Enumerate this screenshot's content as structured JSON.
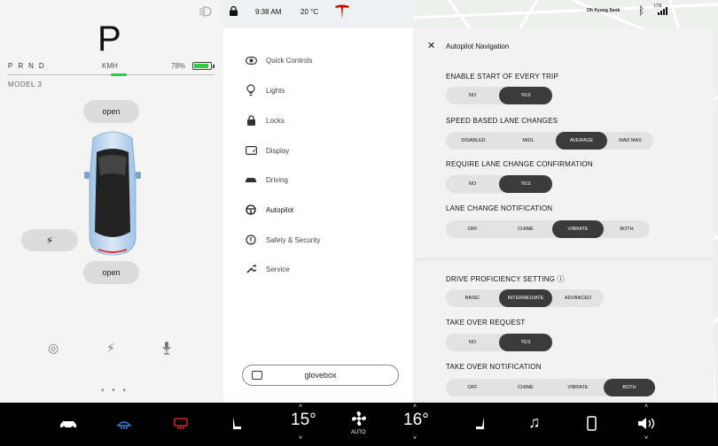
{
  "left": {
    "gear": "P",
    "prnd": [
      "P",
      "R",
      "N",
      "D"
    ],
    "speed_unit": "KMH",
    "battery_pct": "78%",
    "battery_level": 0.78,
    "model": "MODEL 3",
    "frunk_label": "open",
    "trunk_label": "open",
    "charge_icon": "lightning-icon",
    "bottom_icons": [
      "camera-icon",
      "lightning-icon",
      "microphone-icon"
    ],
    "dots": "• • •"
  },
  "status": {
    "time": "9:38 AM",
    "temperature": "20 °C",
    "user": "Oh Kyung Seok",
    "network": "LTE"
  },
  "menu": {
    "items": [
      {
        "label": "Quick Controls",
        "icon": "toggle-icon"
      },
      {
        "label": "Lights",
        "icon": "bulb-icon"
      },
      {
        "label": "Locks",
        "icon": "lock-icon"
      },
      {
        "label": "Display",
        "icon": "display-icon"
      },
      {
        "label": "Driving",
        "icon": "car-icon"
      },
      {
        "label": "Autopilot",
        "icon": "steering-wheel-icon"
      },
      {
        "label": "Safety & Security",
        "icon": "alert-icon"
      },
      {
        "label": "Service",
        "icon": "wrench-icon"
      }
    ],
    "glovebox": "glovebox"
  },
  "panel": {
    "title": "Autopilot Navigation",
    "settings": [
      {
        "label": "ENABLE START OF EVERY TRIP",
        "options": [
          "NO",
          "YES"
        ],
        "selected": 1
      },
      {
        "label": "SPEED BASED LANE CHANGES",
        "options": [
          "DISABLED",
          "MIDL",
          "AVERAGE",
          "MAD MAX"
        ],
        "selected": 2
      },
      {
        "label": "REQUIRE LANE CHANGE CONFIRMATION",
        "options": [
          "NO",
          "YES"
        ],
        "selected": 1
      },
      {
        "label": "LANE CHANGE NOTIFICATION",
        "options": [
          "OFF",
          "CHIME",
          "VIBRATE",
          "BOTH"
        ],
        "selected": 2
      },
      {
        "label": "DRIVE PROFICIENCY SETTING",
        "options": [
          "BASIC",
          "INTERMEDIATE",
          "ADVANCED"
        ],
        "selected": 1
      },
      {
        "label": "TAKE OVER REQUEST",
        "options": [
          "NO",
          "YES"
        ],
        "selected": 1
      },
      {
        "label": "TAKE OVER NOTIFICATION",
        "options": [
          "OFF",
          "CHIME",
          "VIBRATE",
          "BOTH"
        ],
        "selected": 3
      }
    ]
  },
  "bottom": {
    "left_temp": "15°",
    "right_temp": "16°",
    "fan_label": "AUTO",
    "icons": [
      "car-icon",
      "defrost-front-icon",
      "defrost-rear-icon",
      "seat-left-icon",
      "fan-icon",
      "seat-right-icon",
      "music-icon",
      "phone-icon",
      "volume-icon"
    ]
  },
  "colors": {
    "accent": "#2ecc40",
    "selected": "#3b3b3b",
    "tesla_red": "#cc0000",
    "defrost_blue": "#2f7fd8",
    "defrost_red": "#d8232a"
  }
}
